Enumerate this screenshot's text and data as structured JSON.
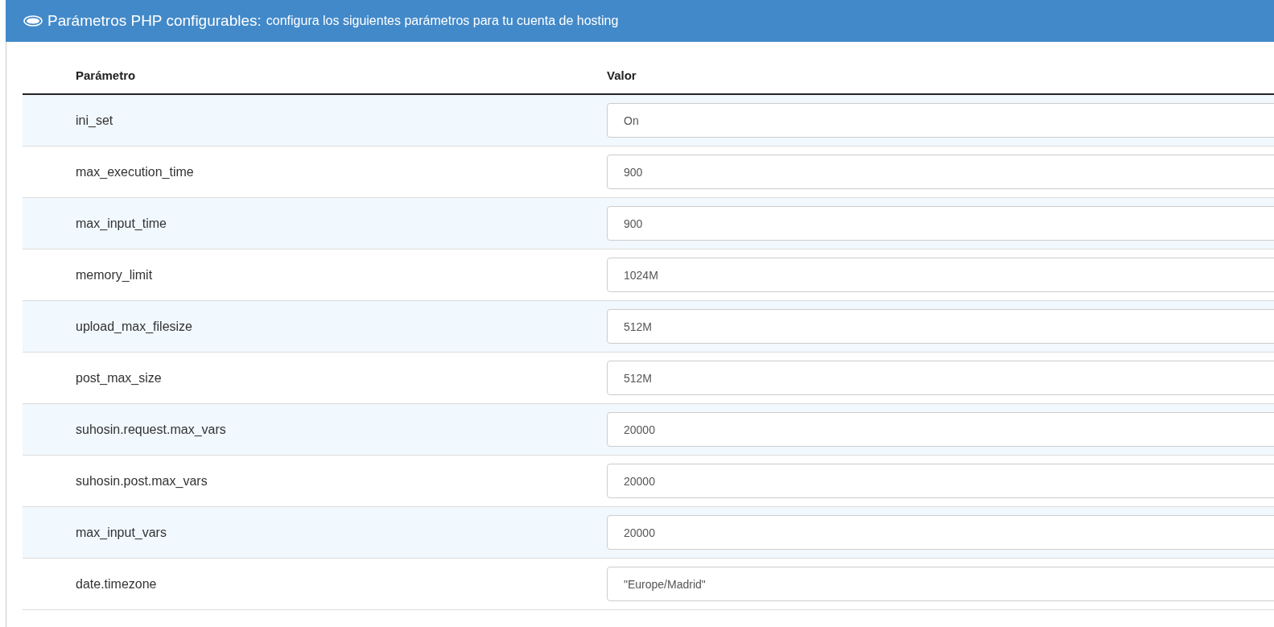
{
  "panel": {
    "title": "Parámetros PHP configurables:",
    "subtitle": "configura los siguientes parámetros para tu cuenta de hosting"
  },
  "table": {
    "columns": [
      "Parámetro",
      "Valor"
    ],
    "rows": [
      {
        "name": "ini_set",
        "value": "On"
      },
      {
        "name": "max_execution_time",
        "value": "900"
      },
      {
        "name": "max_input_time",
        "value": "900"
      },
      {
        "name": "memory_limit",
        "value": "1024M"
      },
      {
        "name": "upload_max_filesize",
        "value": "512M"
      },
      {
        "name": "post_max_size",
        "value": "512M"
      },
      {
        "name": "suhosin.request.max_vars",
        "value": "20000"
      },
      {
        "name": "suhosin.post.max_vars",
        "value": "20000"
      },
      {
        "name": "max_input_vars",
        "value": "20000"
      },
      {
        "name": "date.timezone",
        "value": "\"Europe/Madrid\""
      }
    ]
  }
}
